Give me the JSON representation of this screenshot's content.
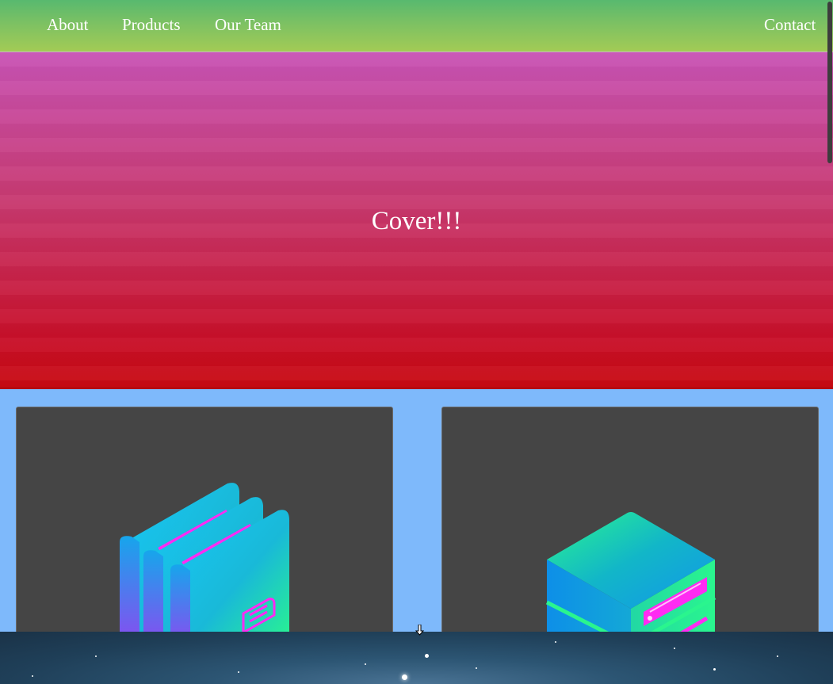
{
  "nav": {
    "items": [
      {
        "label": "About"
      },
      {
        "label": "Products"
      },
      {
        "label": "Our Team"
      }
    ],
    "contact_label": "Contact"
  },
  "cover": {
    "title": "Cover!!!"
  },
  "products": {
    "cards": [
      {
        "icon": "folders-icon"
      },
      {
        "icon": "server-cube-icon"
      }
    ]
  },
  "colors": {
    "nav_gradient": [
      "#58b96f",
      "#a3cb55"
    ],
    "cover_gradient": [
      "#c853b5",
      "#c80a12"
    ],
    "section_bg": "#7eb9fb",
    "card_bg": "#454545"
  }
}
